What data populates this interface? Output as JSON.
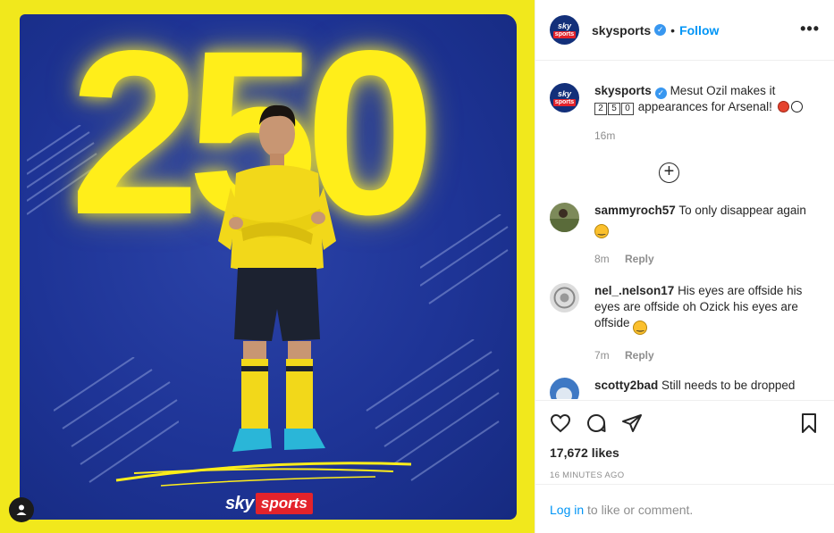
{
  "photo": {
    "headline_number": "250",
    "brand_sky": "sky",
    "brand_sports": "sports",
    "colors": {
      "background": "#f1e81c",
      "panel": "#1e3496",
      "number": "#ffee1a",
      "brand_red": "#e3232b"
    }
  },
  "header": {
    "logo_top": "sky",
    "logo_bottom": "sports",
    "username": "skysports",
    "verified_icon": "verified-badge",
    "separator": "•",
    "follow_label": "Follow",
    "more_label": "•••"
  },
  "caption": {
    "username": "skysports",
    "text_before": "Mesut Ozil makes it",
    "digits": [
      "2",
      "5",
      "0"
    ],
    "text_after": "appearances for Arsenal!",
    "time": "16m"
  },
  "comments": [
    {
      "username": "sammyroch57",
      "text": "To only disappear again",
      "time": "8m",
      "reply_label": "Reply"
    },
    {
      "username": "nel_.nelson17",
      "text": "His eyes are offside his eyes are offside oh Ozick his eyes are offside",
      "time": "7m",
      "reply_label": "Reply"
    },
    {
      "username": "scotty2bad",
      "text": "Still needs to be dropped"
    }
  ],
  "actions": {
    "likes": "17,672 likes",
    "timestamp": "16 MINUTES AGO"
  },
  "login": {
    "link_label": "Log in",
    "rest_text": "to like or comment."
  }
}
